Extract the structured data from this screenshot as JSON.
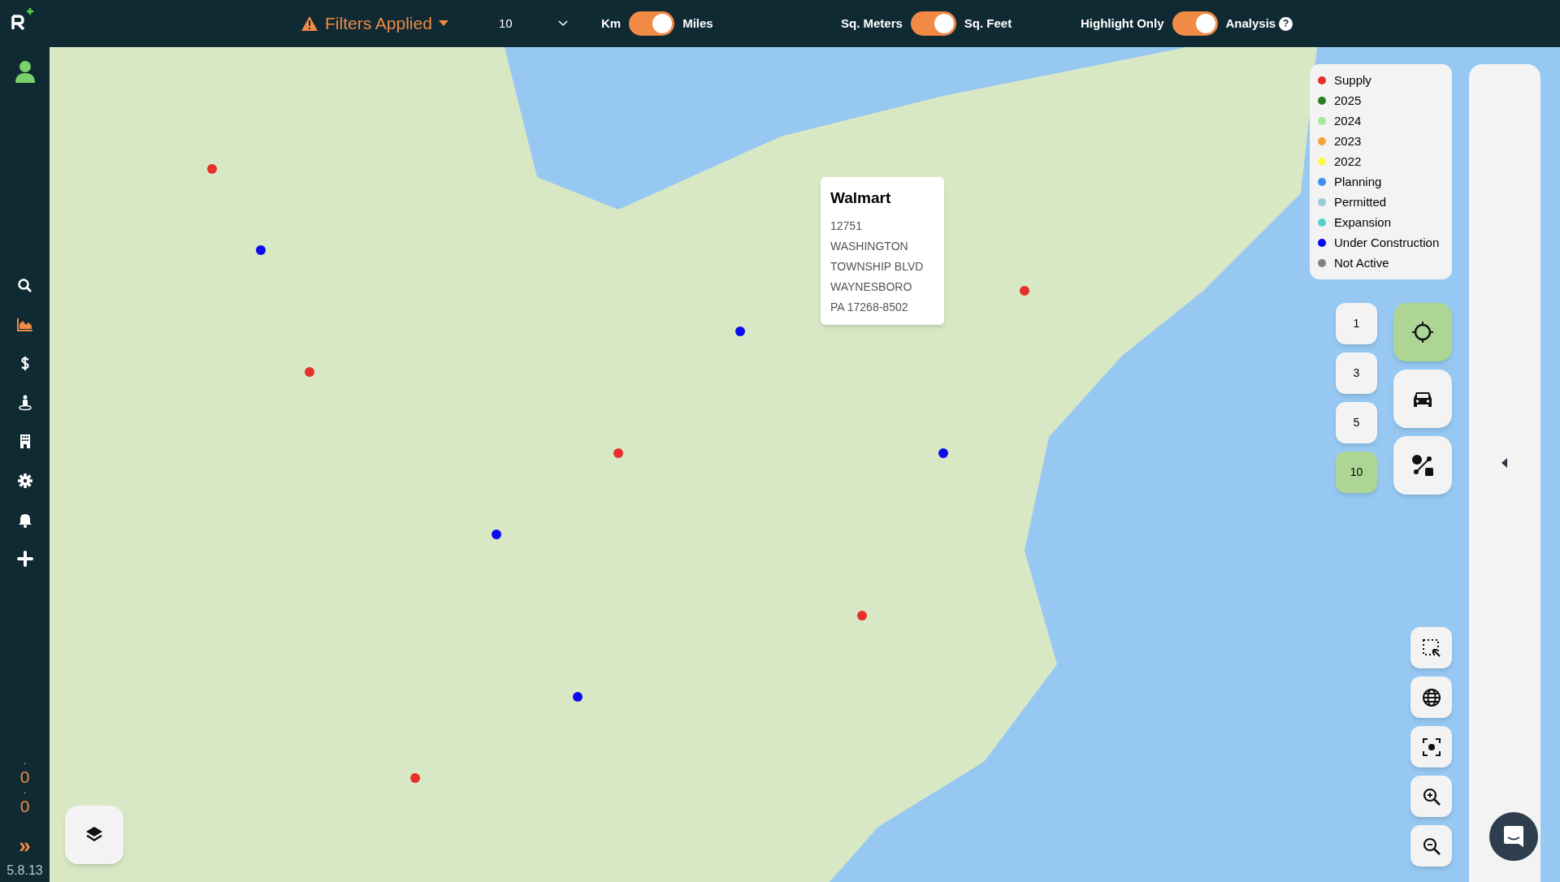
{
  "top_bar": {
    "filters": "Filters Applied",
    "radius_select": "10",
    "toggles": [
      {
        "left": "Km",
        "right": "Miles",
        "on": true
      },
      {
        "left": "Sq. Meters",
        "right": "Sq. Feet",
        "on": true
      },
      {
        "left": "Highlight Only",
        "right": "Analysis",
        "on": true,
        "help": "?"
      }
    ]
  },
  "sidebar": {
    "items": [
      {
        "kind": "search",
        "selected": false
      },
      {
        "kind": "chart",
        "selected": true
      },
      {
        "kind": "dollar",
        "selected": false
      },
      {
        "kind": "person",
        "selected": false
      },
      {
        "kind": "building",
        "selected": false
      },
      {
        "kind": "gear",
        "selected": false
      },
      {
        "kind": "bell",
        "selected": false
      },
      {
        "kind": "plus",
        "selected": false
      }
    ],
    "counters": [
      {
        "dot": "·",
        "value": "0"
      },
      {
        "dot": "·",
        "value": "0"
      }
    ],
    "expand": "»",
    "version": "5.8.13"
  },
  "popup": {
    "title": "Walmart",
    "lines": [
      "12751",
      "WASHINGTON",
      "TOWNSHIP BLVD",
      "WAYNESBORO",
      "PA 17268-8502"
    ]
  },
  "legend": [
    {
      "label": "Supply",
      "color": "#e8302a"
    },
    {
      "label": "2025",
      "color": "#2f7d24"
    },
    {
      "label": "2024",
      "color": "#a5e89a"
    },
    {
      "label": "2023",
      "color": "#f2a535"
    },
    {
      "label": "2022",
      "color": "#fafa46"
    },
    {
      "label": "Planning",
      "color": "#3f8ef2"
    },
    {
      "label": "Permitted",
      "color": "#9ccddc"
    },
    {
      "label": "Expansion",
      "color": "#58cfcf"
    },
    {
      "label": "Under Construction",
      "color": "#0b0bf0"
    },
    {
      "label": "Not Active",
      "color": "#808080"
    }
  ],
  "radius_buttons": [
    {
      "label": "1",
      "selected": false
    },
    {
      "label": "3",
      "selected": false
    },
    {
      "label": "5",
      "selected": false
    },
    {
      "label": "10",
      "selected": true
    }
  ],
  "mode_buttons": [
    {
      "kind": "crosshair",
      "selected": true
    },
    {
      "kind": "car",
      "selected": false
    },
    {
      "kind": "route",
      "selected": false
    }
  ],
  "map_tools": [
    {
      "kind": "select"
    },
    {
      "kind": "globe"
    },
    {
      "kind": "focus"
    },
    {
      "kind": "zoom-in"
    },
    {
      "kind": "zoom-out"
    }
  ]
}
